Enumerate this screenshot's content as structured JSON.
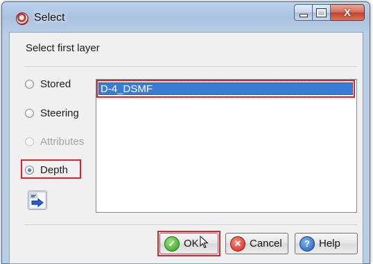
{
  "window": {
    "title": "Select",
    "close_glyph": "X"
  },
  "dialog": {
    "prompt": "Select first layer",
    "layer_types": [
      {
        "label": "Stored",
        "checked": false,
        "enabled": true
      },
      {
        "label": "Steering",
        "checked": false,
        "enabled": true
      },
      {
        "label": "Attributes",
        "checked": false,
        "enabled": false
      },
      {
        "label": "Depth",
        "checked": true,
        "enabled": true
      }
    ],
    "import_icon": "seg-import-icon",
    "layers": [
      {
        "name": "D-4_DSMF",
        "selected": true
      }
    ]
  },
  "buttons": {
    "ok": "OK",
    "cancel": "Cancel",
    "help": "Help"
  },
  "highlight_color": "#e0202a",
  "selection_color": "#3a7bd5"
}
